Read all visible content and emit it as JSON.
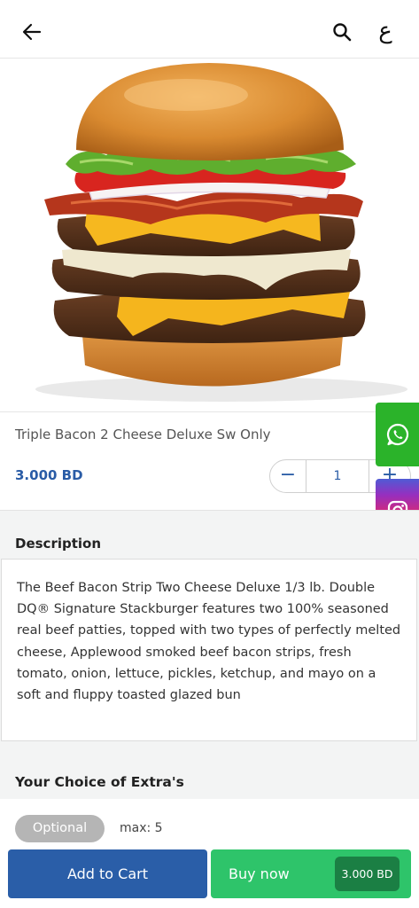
{
  "header": {
    "back_icon": "arrow-left-icon",
    "search_icon": "search-icon",
    "language_toggle": "ع"
  },
  "product": {
    "name": "Triple Bacon 2 Cheese Deluxe Sw Only",
    "price": "3.000 BD",
    "quantity": "1",
    "minus_symbol": "−",
    "plus_symbol": "+"
  },
  "social": {
    "whatsapp_icon": "whatsapp-icon",
    "instagram_icon": "instagram-icon"
  },
  "description": {
    "title": "Description",
    "text": "The Beef Bacon Strip Two Cheese Deluxe 1/3 lb. Double DQ® Signature Stackburger features two 100% seasoned real beef patties, topped with two types of perfectly melted cheese, Applewood smoked beef bacon strips, fresh tomato, onion, lettuce, pickles, ketchup, and mayo on a soft and fluppy toasted glazed bun"
  },
  "extras": {
    "title": "Your Choice of Extra's",
    "optional_label": "Optional",
    "max_label": "max: 5"
  },
  "actions": {
    "add_to_cart": "Add to Cart",
    "buy_now": "Buy now",
    "buy_price": "3.000 BD"
  },
  "colors": {
    "primary_blue": "#2a5ea8",
    "buy_green": "#2ec46a",
    "buy_price_bg": "#1b7f44",
    "whatsapp_green": "#2bb32a",
    "price_text": "#2a5ca6"
  }
}
